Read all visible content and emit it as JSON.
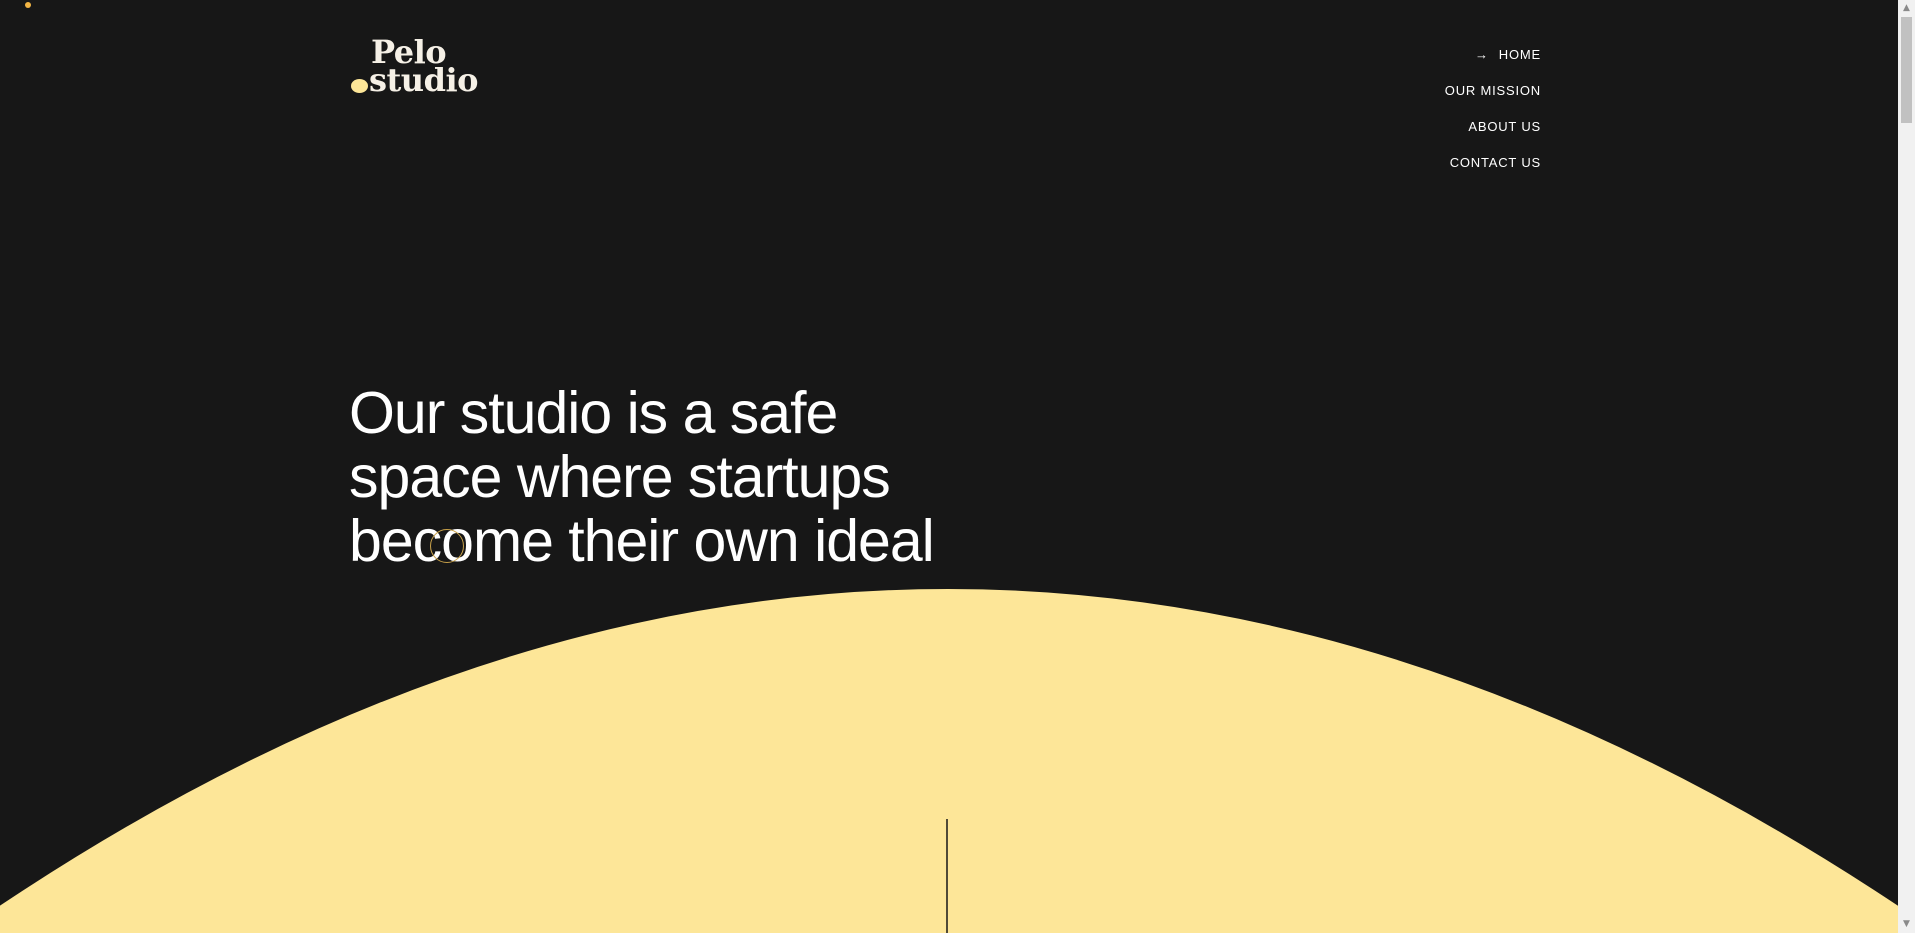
{
  "brand": {
    "logo_line1": "Pelo",
    "logo_line2": "studio",
    "accent_color": "#fde698",
    "background_color": "#171717"
  },
  "nav": {
    "items": [
      {
        "label": "HOME",
        "active": true,
        "icon": "arrow-right-icon",
        "icon_glyph": "→"
      },
      {
        "label": "OUR MISSION"
      },
      {
        "label": "ABOUT US"
      },
      {
        "label": "CONTACT US"
      }
    ]
  },
  "hero": {
    "line1": "Our studio is a safe",
    "line2": "space where startups",
    "line3": "become their own ideal"
  },
  "scrollbar": {
    "up_glyph": "▲",
    "down_glyph": "▼"
  }
}
